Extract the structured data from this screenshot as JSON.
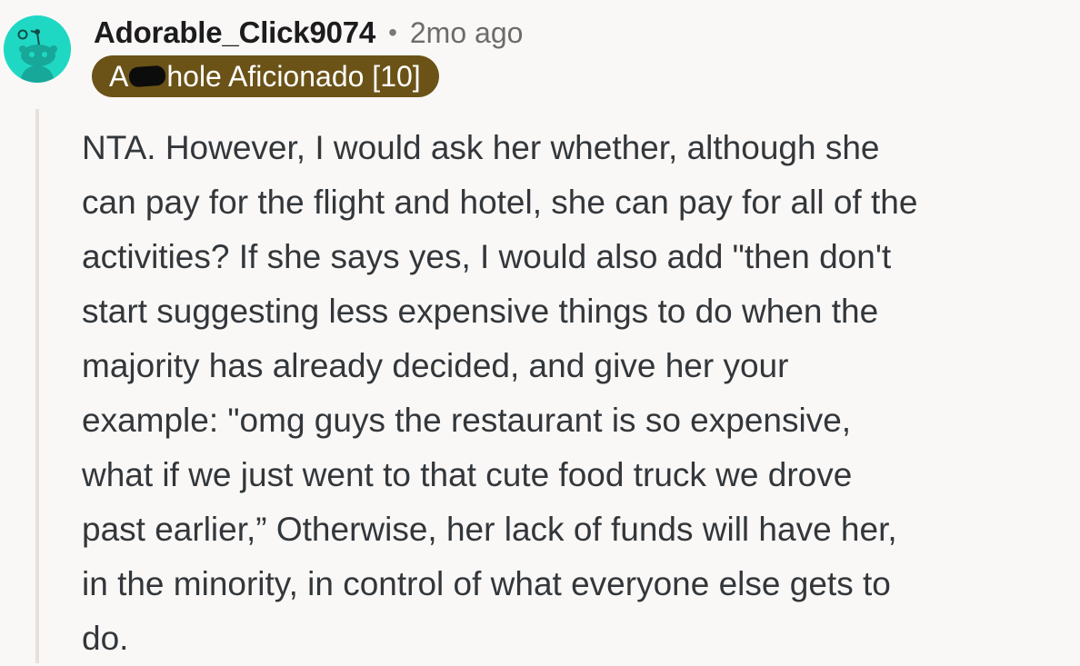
{
  "comment": {
    "author": "Adorable_Click9074",
    "separator": "•",
    "timestamp": "2mo ago",
    "flair": {
      "prefix": "A",
      "suffix": "hole Aficionado [10]",
      "color": "#6b5317"
    },
    "avatar": {
      "icon": "reddit-snoo-avatar-icon",
      "color": "#1fd8c4"
    },
    "body_lines": [
      "NTA. However, I would ask her whether, although she",
      "can pay for the flight and hotel, she can pay for all of the",
      "activities? If she says yes, I would also add \"then don't",
      "start suggesting less expensive things to do when the",
      "majority has already decided, and give her your",
      "example: \"omg guys the restaurant is so expensive,",
      "what if we just went to that cute food truck we drove",
      "past earlier,” Otherwise, her lack of funds will have her,",
      "in the minority, in control of what everyone else gets to",
      "do."
    ]
  }
}
